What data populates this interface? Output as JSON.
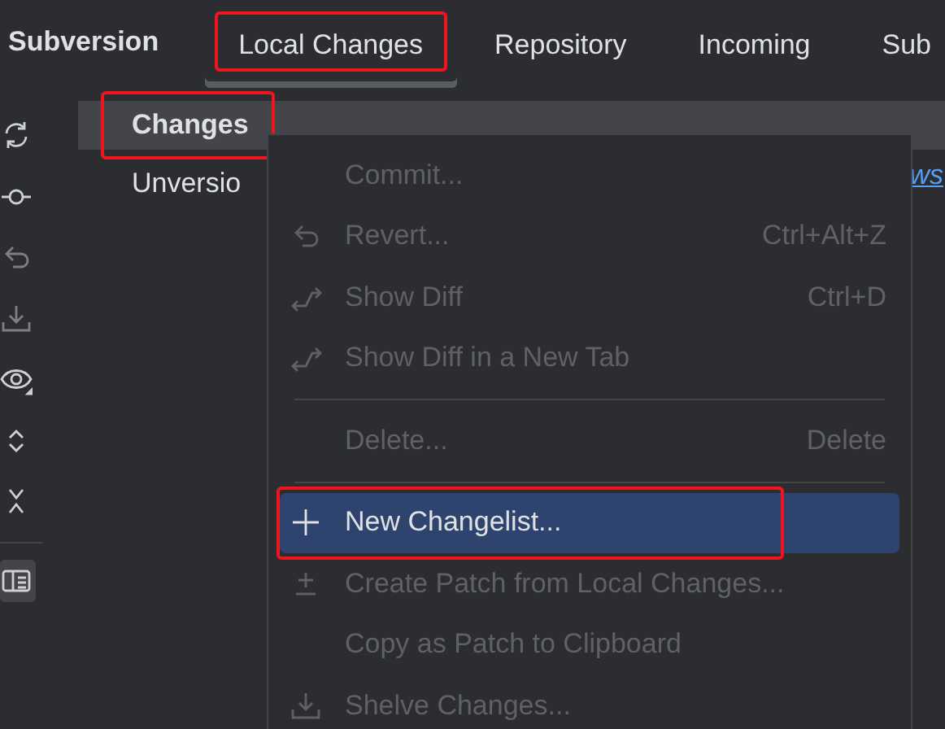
{
  "title": "Subversion",
  "tabs": [
    {
      "label": "Local Changes",
      "selected": true,
      "annotated": true
    },
    {
      "label": "Repository",
      "selected": false,
      "annotated": false
    },
    {
      "label": "Incoming",
      "selected": false,
      "annotated": false
    },
    {
      "label": "Sub",
      "selected": false,
      "annotated": false
    }
  ],
  "toolbar": [
    {
      "selected": false
    },
    {
      "selected": false
    },
    {
      "selected": false
    },
    {
      "selected": false
    },
    {
      "selected": false
    },
    {
      "selected": false
    },
    {
      "selected": false
    },
    {
      "selected": true
    }
  ],
  "tree": [
    {
      "label": "Changes",
      "selected": true,
      "annotated": true
    },
    {
      "label": "Unversio",
      "selected": false,
      "annotated": false
    }
  ],
  "link_fragment": "ws",
  "menu": [
    {
      "kind": "item",
      "label": "Commit...",
      "disabled": true,
      "selected": false,
      "annotated": false
    },
    {
      "kind": "item",
      "label": "Revert...",
      "shortcut": "Ctrl+Alt+Z",
      "disabled": true,
      "selected": false,
      "annotated": false
    },
    {
      "kind": "item",
      "label": "Show Diff",
      "shortcut": "Ctrl+D",
      "disabled": true,
      "selected": false,
      "annotated": false
    },
    {
      "kind": "item",
      "label": "Show Diff in a New Tab",
      "disabled": true,
      "selected": false,
      "annotated": false
    },
    {
      "kind": "separator"
    },
    {
      "kind": "item",
      "label": "Delete...",
      "shortcut": "Delete",
      "disabled": true,
      "selected": false,
      "annotated": false
    },
    {
      "kind": "separator"
    },
    {
      "kind": "item",
      "label": "New Changelist...",
      "disabled": false,
      "selected": true,
      "annotated": true
    },
    {
      "kind": "item",
      "label": "Create Patch from Local Changes...",
      "disabled": true,
      "selected": false,
      "annotated": false
    },
    {
      "kind": "item",
      "label": "Copy as Patch to Clipboard",
      "disabled": true,
      "selected": false,
      "annotated": false
    },
    {
      "kind": "item",
      "label": "Shelve Changes...",
      "disabled": true,
      "selected": false,
      "annotated": false
    }
  ]
}
